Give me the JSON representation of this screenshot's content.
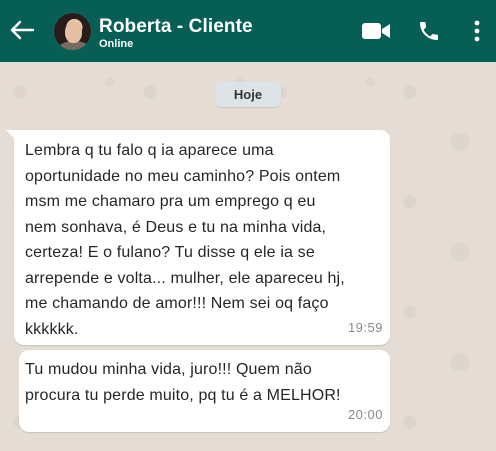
{
  "header": {
    "contact_name": "Roberta - Cliente",
    "status": "Online",
    "background_color": "#075e54",
    "icons": [
      "back-arrow-icon",
      "video-call-icon",
      "phone-icon",
      "more-vertical-icon"
    ]
  },
  "chat": {
    "date_chip": "Hoje",
    "messages": [
      {
        "text": "Lembra q tu falo q ia aparece uma\noportunidade no meu caminho? Pois ontem\nmsm me chamaro pra um emprego q eu\nnem sonhava, é Deus e tu na minha vida,\ncerteza! E o fulano? Tu disse q ele ia se\narrepende e volta... mulher, ele apareceu hj,\nme chamando de amor!!! Nem sei oq faço\nkkkkkk.",
        "time": "19:59"
      },
      {
        "text": "Tu mudou minha vida, juro!!! Quem não\nprocura tu perde muito, pq tu é a MELHOR!",
        "time": "20:00"
      }
    ]
  }
}
